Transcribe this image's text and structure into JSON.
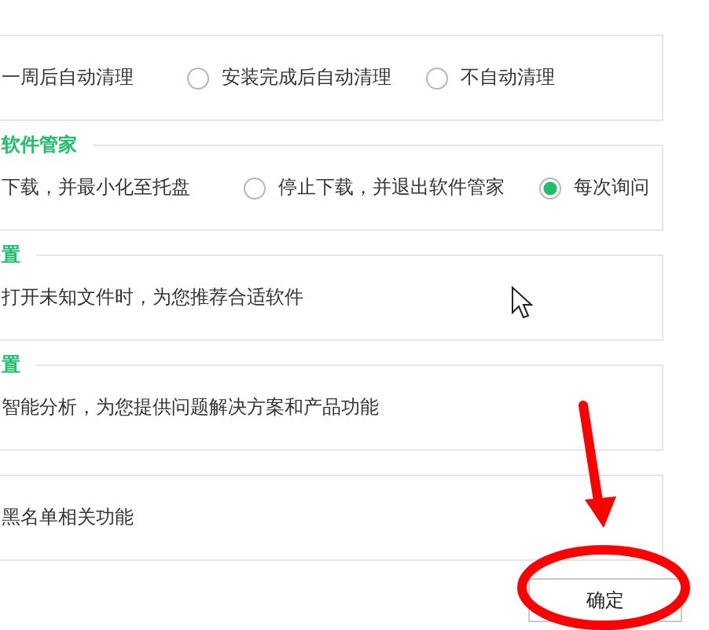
{
  "sections": [
    {
      "kind": "radios",
      "options": [
        {
          "label": "一周后自动清理"
        },
        {
          "label": "安装完成后自动清理",
          "selected": false
        },
        {
          "label": "不自动清理",
          "selected": false
        }
      ]
    },
    {
      "kind": "radios",
      "title": "软件管家",
      "options": [
        {
          "label": "下载，并最小化至托盘"
        },
        {
          "label": "停止下载，并退出软件管家",
          "selected": false
        },
        {
          "label": "每次询问",
          "selected": true
        }
      ]
    },
    {
      "kind": "text",
      "title": "置",
      "text": "打开未知文件时，为您推荐合适软件"
    },
    {
      "kind": "text",
      "title": "置",
      "text": "智能分析，为您提供问题解决方案和产品功能"
    },
    {
      "kind": "text",
      "text": "黑名单相关功能"
    }
  ],
  "buttons": [
    {
      "label": "确定"
    }
  ]
}
